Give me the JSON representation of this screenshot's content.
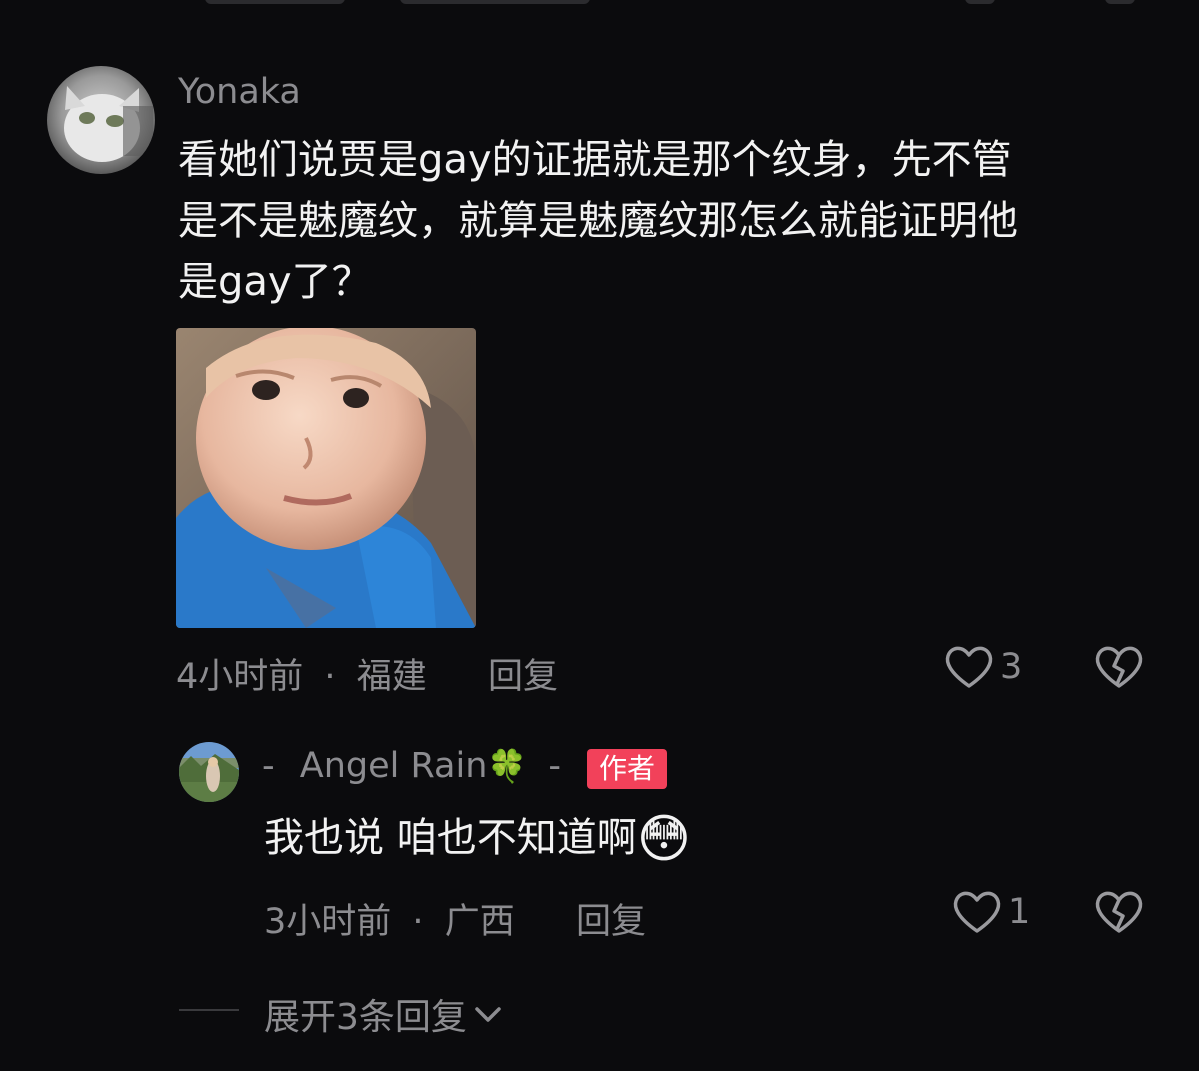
{
  "comment": {
    "username": "Yonaka",
    "text_lines": [
      "看她们说贾是gay的证据就是那个纹身，先不管",
      "是不是魅魔纹，就算是魅魔纹那怎么就能证明他",
      "是gay了？"
    ],
    "image_alt": "boy-meme",
    "time": "4小时前",
    "separator": "·",
    "location": "福建",
    "reply_label": "回复",
    "like_count": "3"
  },
  "reply": {
    "username_prefix": "-",
    "username": "Angel Rain",
    "username_emoji": "🍀",
    "username_suffix": "-",
    "badge": "作者",
    "text": "我也说 咱也不知道啊",
    "emoji": "😳",
    "time": "3小时前",
    "separator": "·",
    "location": "广西",
    "reply_label": "回复",
    "like_count": "1"
  },
  "expand": {
    "label": "展开3条回复"
  },
  "colors": {
    "background": "#0b0b0d",
    "text": "#f2f2f2",
    "muted": "#8c8c90",
    "badge": "#f2415a"
  }
}
